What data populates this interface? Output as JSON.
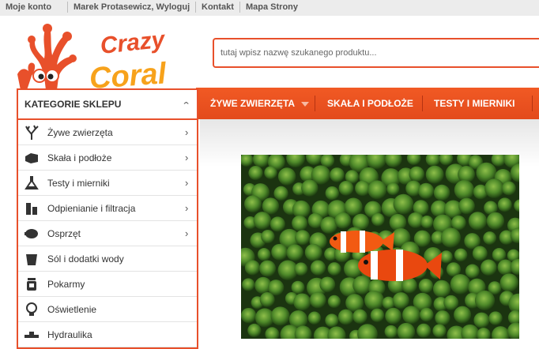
{
  "topbar": {
    "links": [
      "Moje konto",
      "Marek Protasewicz, Wyloguj",
      "Kontakt",
      "Mapa Strony"
    ]
  },
  "logo": {
    "text_line1": "Crazy",
    "text_line2": "Coral",
    "icon": "coral-logo-icon"
  },
  "search": {
    "placeholder": "tutaj wpisz nazwę szukanego produktu..."
  },
  "nav": {
    "items": [
      "ŻYWE ZWIERZĘTA",
      "SKAŁA I PODŁOŻE",
      "TESTY I MIERNIKI"
    ]
  },
  "categories": {
    "title": "KATEGORIE SKLEPU",
    "items": [
      {
        "label": "Żywe zwierzęta",
        "icon": "coral-icon",
        "has_submenu": true
      },
      {
        "label": "Skała i podłoże",
        "icon": "rock-icon",
        "has_submenu": true
      },
      {
        "label": "Testy i mierniki",
        "icon": "flask-icon",
        "has_submenu": true
      },
      {
        "label": "Odpienianie i filtracja",
        "icon": "skimmer-icon",
        "has_submenu": true
      },
      {
        "label": "Osprzęt",
        "icon": "pump-icon",
        "has_submenu": true
      },
      {
        "label": "Sól i dodatki wody",
        "icon": "salt-bucket-icon",
        "has_submenu": false
      },
      {
        "label": "Pokarmy",
        "icon": "food-jar-icon",
        "has_submenu": false
      },
      {
        "label": "Oświetlenie",
        "icon": "light-bulb-icon",
        "has_submenu": false
      },
      {
        "label": "Hydraulika",
        "icon": "pipe-icon",
        "has_submenu": false
      }
    ]
  },
  "colors": {
    "accent": "#e8502b",
    "nav_bg": "#f15a24",
    "topbar_bg": "#ececec"
  },
  "banner": {
    "image": "clownfish-in-anemone"
  }
}
